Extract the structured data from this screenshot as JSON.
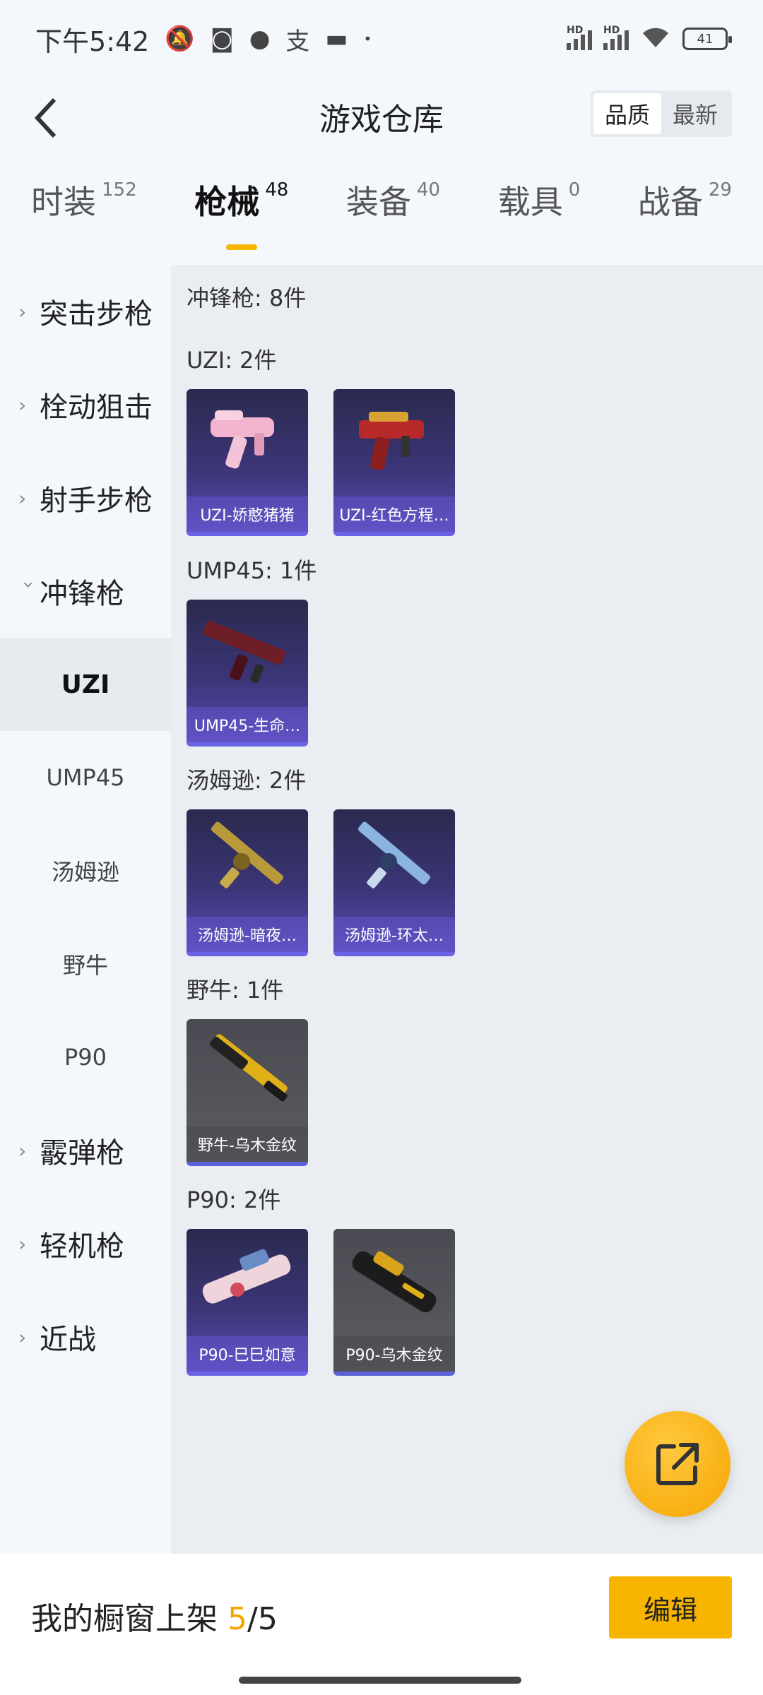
{
  "status_bar": {
    "time": "下午5:42",
    "battery": "41",
    "icons": [
      "bell-off-icon",
      "nfc-icon",
      "qq-icon",
      "alipay-icon",
      "message-icon",
      "dot-icon"
    ],
    "signal_label": "HD"
  },
  "header": {
    "title": "游戏仓库",
    "sort_options": [
      "品质",
      "最新"
    ],
    "active_sort": "品质"
  },
  "tabs": [
    {
      "label": "时装",
      "count": "152"
    },
    {
      "label": "枪械",
      "count": "48",
      "active": true
    },
    {
      "label": "装备",
      "count": "40"
    },
    {
      "label": "载具",
      "count": "0"
    },
    {
      "label": "战备",
      "count": "29"
    }
  ],
  "sidebar": {
    "categories_top": [
      "突击步枪",
      "栓动狙击",
      "射手步枪"
    ],
    "open_category": "冲锋枪",
    "subcategories": [
      "UZI",
      "UMP45",
      "汤姆逊",
      "野牛",
      "P90"
    ],
    "active_sub": "UZI",
    "categories_bottom": [
      "霰弹枪",
      "轻机枪",
      "近战"
    ]
  },
  "content": {
    "summary": "冲锋枪: 8件",
    "groups": [
      {
        "title": "UZI: 2件",
        "items": [
          {
            "name": "UZI-娇憨猪猪",
            "icon": "pink-smg-icon",
            "tone": "purple"
          },
          {
            "name": "UZI-红色方程…",
            "icon": "red-smg-icon",
            "tone": "purple"
          }
        ]
      },
      {
        "title": "UMP45: 1件",
        "items": [
          {
            "name": "UMP45-生命…",
            "icon": "dark-red-smg-icon",
            "tone": "purple"
          }
        ]
      },
      {
        "title": "汤姆逊: 2件",
        "items": [
          {
            "name": "汤姆逊-暗夜…",
            "icon": "gold-tommy-gun-icon",
            "tone": "purple"
          },
          {
            "name": "汤姆逊-环太…",
            "icon": "blue-tommy-gun-icon",
            "tone": "purple"
          }
        ]
      },
      {
        "title": "野牛: 1件",
        "items": [
          {
            "name": "野牛-乌木金纹",
            "icon": "gold-bizon-icon",
            "tone": "gray"
          }
        ]
      },
      {
        "title": "P90: 2件",
        "items": [
          {
            "name": "P90-巳巳如意",
            "icon": "pink-p90-icon",
            "tone": "purple"
          },
          {
            "name": "P90-乌木金纹",
            "icon": "black-gold-p90-icon",
            "tone": "gray"
          }
        ]
      }
    ]
  },
  "bottom_bar": {
    "showcase_label": "我的橱窗上架",
    "showcase_current": "5",
    "showcase_total": "/5",
    "edit_label": "编辑"
  },
  "fab": {
    "icon": "share-out-icon"
  }
}
